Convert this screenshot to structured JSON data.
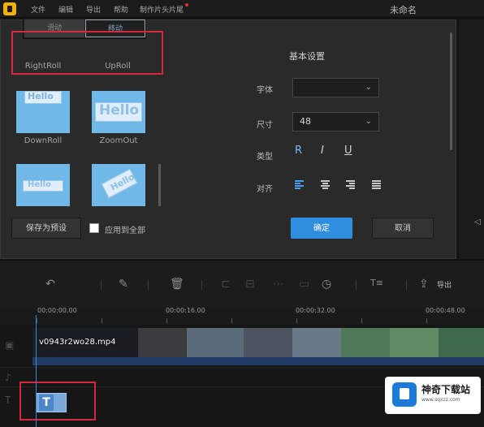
{
  "menubar": {
    "items": [
      "文件",
      "编辑",
      "导出",
      "帮助",
      "制作片头片尾"
    ],
    "window_title": "未命名"
  },
  "dialog": {
    "toggle": {
      "left": "滑动",
      "right": "移动"
    },
    "animations": [
      {
        "label": "RightRoll"
      },
      {
        "label": "UpRoll"
      },
      {
        "label": "DownRoll",
        "thumb_text": "Hello"
      },
      {
        "label": "ZoomOut",
        "thumb_text": "Hello"
      },
      {
        "label": "",
        "thumb_text": "Hello"
      },
      {
        "label": "",
        "thumb_text": "Hello"
      }
    ],
    "save_preset_label": "保存为预设",
    "apply_all_label": "应用到全部",
    "settings": {
      "title": "基本设置",
      "font_label": "字体",
      "font_value": "",
      "size_label": "尺寸",
      "size_value": "48",
      "style_label": "类型",
      "style_buttons": [
        "R",
        "I",
        "U"
      ],
      "align_label": "对齐",
      "align_options": [
        "left",
        "center",
        "right",
        "justify"
      ],
      "align_active": "left"
    },
    "ok_label": "确定",
    "cancel_label": "取消"
  },
  "toolbar": {
    "icons": [
      "undo-icon",
      "pen-icon",
      "delete-icon",
      "crop-icon",
      "timer-icon",
      "text-voice-icon",
      "export-icon"
    ],
    "export_label": "导出"
  },
  "timeline": {
    "ticks": [
      "00:00:00.00",
      "00:00:16.00",
      "00:00:32.00",
      "00:00:48.00"
    ],
    "video_clip_name": "v0943r2wo28.mp4",
    "text_clip_glyph": "T"
  },
  "watermark": {
    "name": "神奇下载站",
    "site": "www.sqxzz.com"
  },
  "colors": {
    "accent": "#2f8de0",
    "highlight_border": "#d6283b",
    "thumb_bg": "#6fb8e8"
  }
}
